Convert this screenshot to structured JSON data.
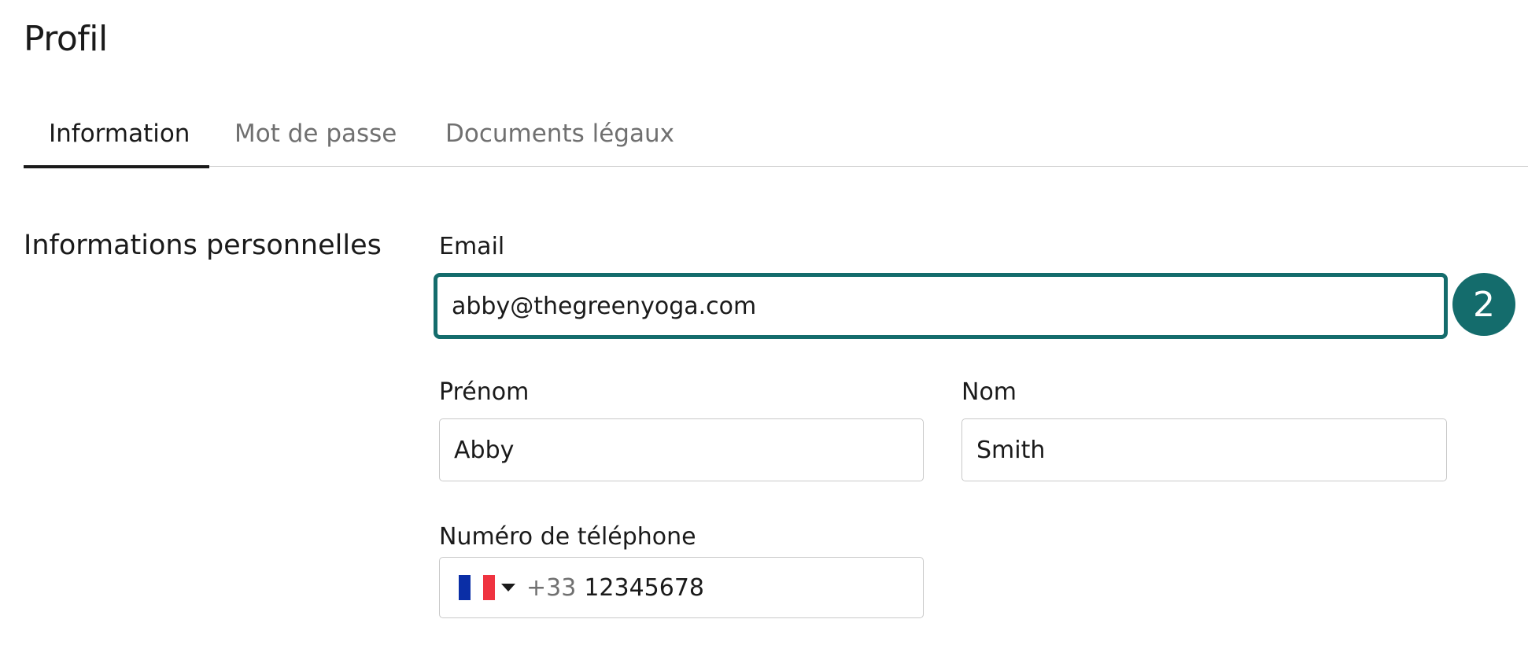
{
  "page": {
    "title": "Profil"
  },
  "tabs": [
    {
      "label": "Information",
      "active": true
    },
    {
      "label": "Mot de passe",
      "active": false
    },
    {
      "label": "Documents légaux",
      "active": false
    }
  ],
  "section": {
    "title": "Informations personnelles"
  },
  "form": {
    "email": {
      "label": "Email",
      "value": "abby@thegreenyoga.com"
    },
    "first_name": {
      "label": "Prénom",
      "value": "Abby"
    },
    "last_name": {
      "label": "Nom",
      "value": "Smith"
    },
    "phone": {
      "label": "Numéro de téléphone",
      "country_flag": "france-flag-icon",
      "dial_code": "+33",
      "number": "12345678"
    }
  },
  "annotation": {
    "step_number": "2"
  },
  "colors": {
    "accent": "#146c6c",
    "flag_blue": "#0a2ea6",
    "flag_white": "#ffffff",
    "flag_red": "#ef3340"
  }
}
